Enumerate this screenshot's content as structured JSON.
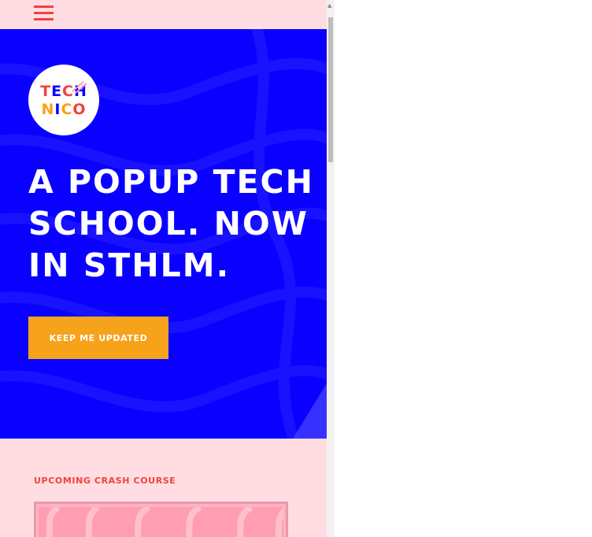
{
  "nav": {
    "menu_icon": "hamburger-menu-icon"
  },
  "logo": {
    "line1": "TECH",
    "line2": "NICO",
    "colors": {
      "red": "#f0433a",
      "blue": "#0a00ff",
      "orange": "#f7a21b",
      "pink": "#ff9bb0"
    }
  },
  "hero": {
    "headline": "A POPUP TECH SCHOOL. NOW IN STHLM.",
    "cta_label": "KEEP ME UPDATED",
    "background": "#0a00ff"
  },
  "courses": {
    "section_title": "UPCOMING CRASH COURSE"
  },
  "scrollbar": {
    "up_arrow": "▲"
  },
  "theme": {
    "page_bg": "#ffdde3",
    "accent_red": "#f0433a",
    "accent_orange": "#f7a21b"
  }
}
